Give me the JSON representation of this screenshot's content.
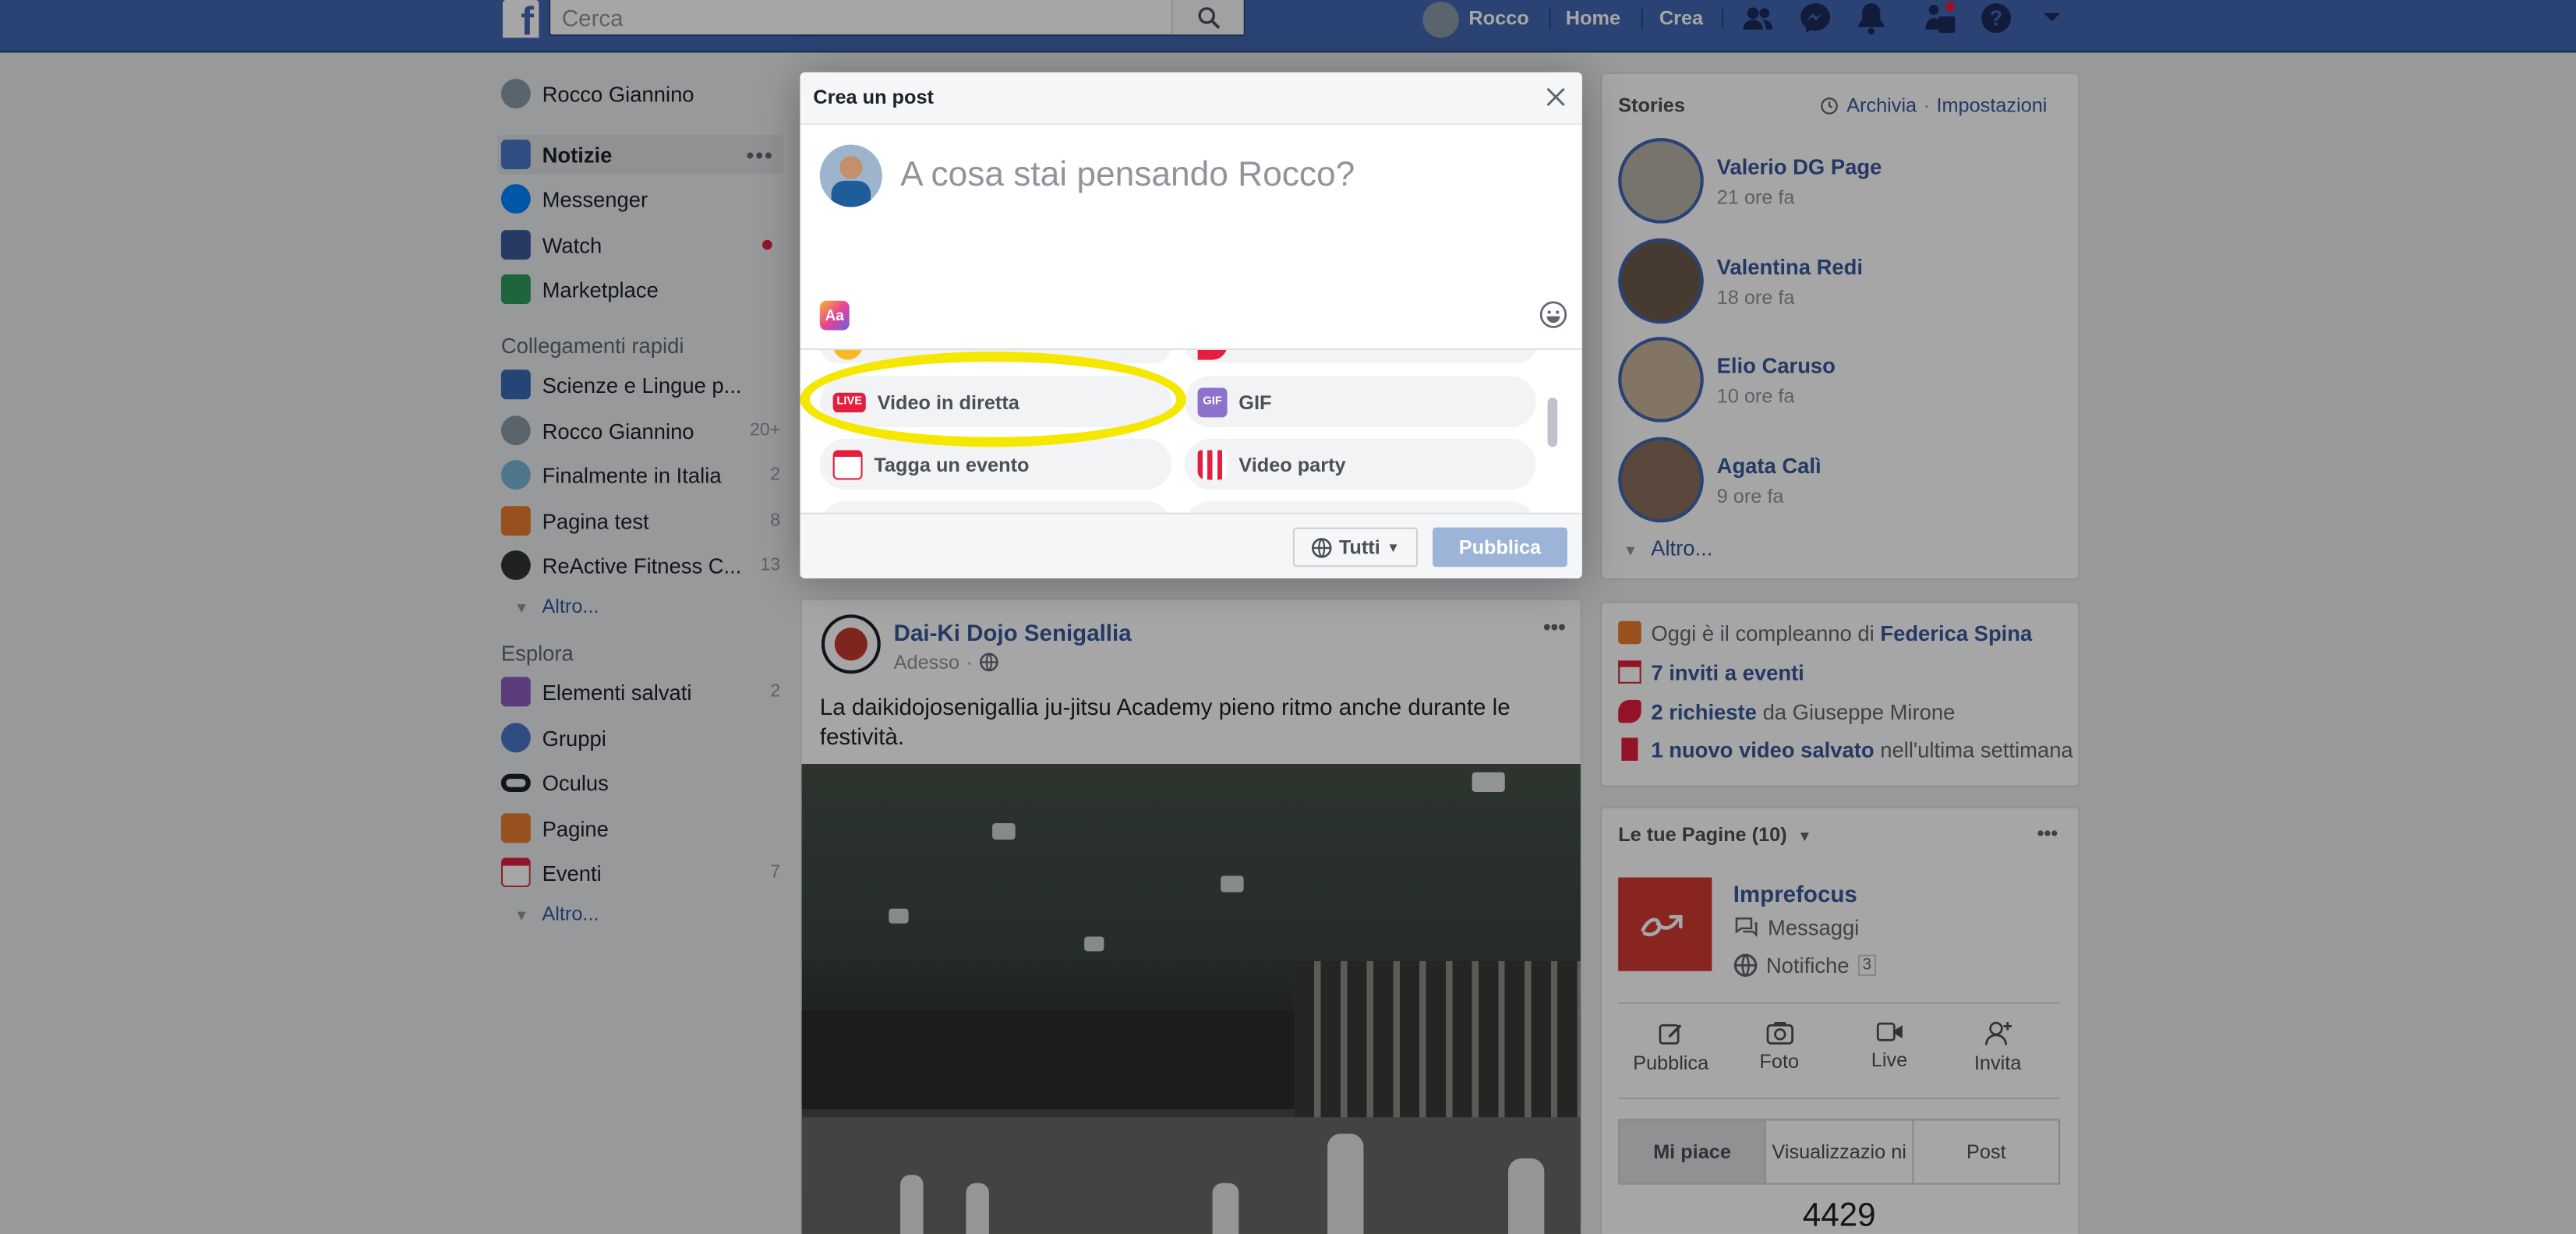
{
  "topbar": {
    "search_placeholder": "Cerca",
    "profile_name": "Rocco",
    "home": "Home",
    "create": "Crea",
    "logo": "f"
  },
  "left": {
    "profile": "Rocco Giannino",
    "nav": [
      {
        "label": "Notizie",
        "more": "•••"
      },
      {
        "label": "Messenger"
      },
      {
        "label": "Watch"
      },
      {
        "label": "Marketplace"
      }
    ],
    "quick_header": "Collegamenti rapidi",
    "quick": [
      {
        "label": "Scienze e Lingue p...",
        "count": ""
      },
      {
        "label": "Rocco Giannino",
        "count": "20+"
      },
      {
        "label": "Finalmente in Italia",
        "count": "2"
      },
      {
        "label": "Pagina test",
        "count": "8"
      },
      {
        "label": "ReActive Fitness C...",
        "count": "13"
      }
    ],
    "more1": "Altro...",
    "explore_header": "Esplora",
    "explore": [
      {
        "label": "Elementi salvati",
        "count": "2"
      },
      {
        "label": "Gruppi",
        "count": ""
      },
      {
        "label": "Oculus",
        "count": ""
      },
      {
        "label": "Pagine",
        "count": ""
      },
      {
        "label": "Eventi",
        "count": "7"
      }
    ],
    "more2": "Altro..."
  },
  "modal": {
    "title": "Crea un post",
    "placeholder": "A cosa stai pensando Rocco?",
    "aa": "Aa",
    "options": [
      {
        "label": "Video in diretta",
        "icon": "live-icon",
        "badge": "LIVE",
        "color": "#e41e3f"
      },
      {
        "label": "GIF",
        "icon": "gif-icon",
        "badge": "GIF",
        "color": "#8c72cb"
      },
      {
        "label": "Tagga un evento",
        "icon": "calendar-icon",
        "color": "#e41e3f"
      },
      {
        "label": "Video party",
        "icon": "popcorn-icon",
        "color": "#f7923b"
      }
    ],
    "audience": "Tutti",
    "publish": "Pubblica"
  },
  "post": {
    "author": "Dai-Ki Dojo Senigallia",
    "time": "Adesso",
    "text": "La daikidojosenigallia ju-jitsu Academy pieno ritmo anche durante le festività.",
    "more": "•••"
  },
  "stories": {
    "title": "Stories",
    "archive": "Archivia",
    "sep": "·",
    "settings": "Impostazioni",
    "items": [
      {
        "name": "Valerio DG Page",
        "time": "21 ore fa"
      },
      {
        "name": "Valentina Redi",
        "time": "18 ore fa"
      },
      {
        "name": "Elio Caruso",
        "time": "10 ore fa"
      },
      {
        "name": "Agata Calì",
        "time": "9 ore fa"
      }
    ],
    "more": "Altro..."
  },
  "events": {
    "bday_text": "Oggi è il compleanno di",
    "bday_name": "Federica Spina",
    "invites": "7 inviti a eventi",
    "requests_link": "2 richieste",
    "requests_rest": "da Giuseppe Mirone",
    "video_link": "1 nuovo video salvato",
    "video_rest": "nell'ultima settimana"
  },
  "pages": {
    "header": "Le tue Pagine (10)",
    "more": "•••",
    "name": "Imprefocus",
    "messages": "Messaggi",
    "notifications": "Notifiche",
    "notif_count": "3",
    "actions": [
      "Pubblica",
      "Foto",
      "Live",
      "Invita"
    ],
    "tabs": [
      "Mi piace",
      "Visualizzazio ni",
      "Post"
    ],
    "likes": "4429"
  },
  "colors": {
    "brand": "#4267b2",
    "link": "#385898",
    "highlight": "#f5e700",
    "notification_dot": "#e41e3f"
  }
}
